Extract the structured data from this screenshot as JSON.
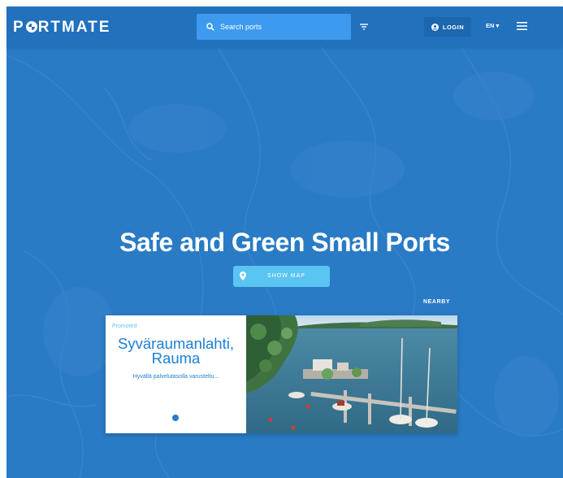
{
  "header": {
    "logo_text_before": "P",
    "logo_text_after": "RTMATE",
    "search_placeholder": "Search ports",
    "login_label": "LOGIN",
    "language": "EN"
  },
  "hero": {
    "title": "Safe and Green Small Ports",
    "show_map_label": "SHOW MAP"
  },
  "nearby_label": "NEARBY",
  "promo_card": {
    "badge": "Promoted",
    "name_line1": "Syväraumanlahti,",
    "name_line2": "Rauma",
    "description": "Hyvällä palvelutasolla varusteltu..."
  },
  "colors": {
    "header_bg": "#2171bd",
    "map_bg": "#2a7bc5",
    "search_bg": "#3d9aef",
    "accent": "#5bc5f2",
    "text_blue": "#1c7fd6"
  },
  "icons": [
    "search-icon",
    "filter-icon",
    "user-icon",
    "hamburger-menu-icon",
    "map-pin-icon"
  ]
}
